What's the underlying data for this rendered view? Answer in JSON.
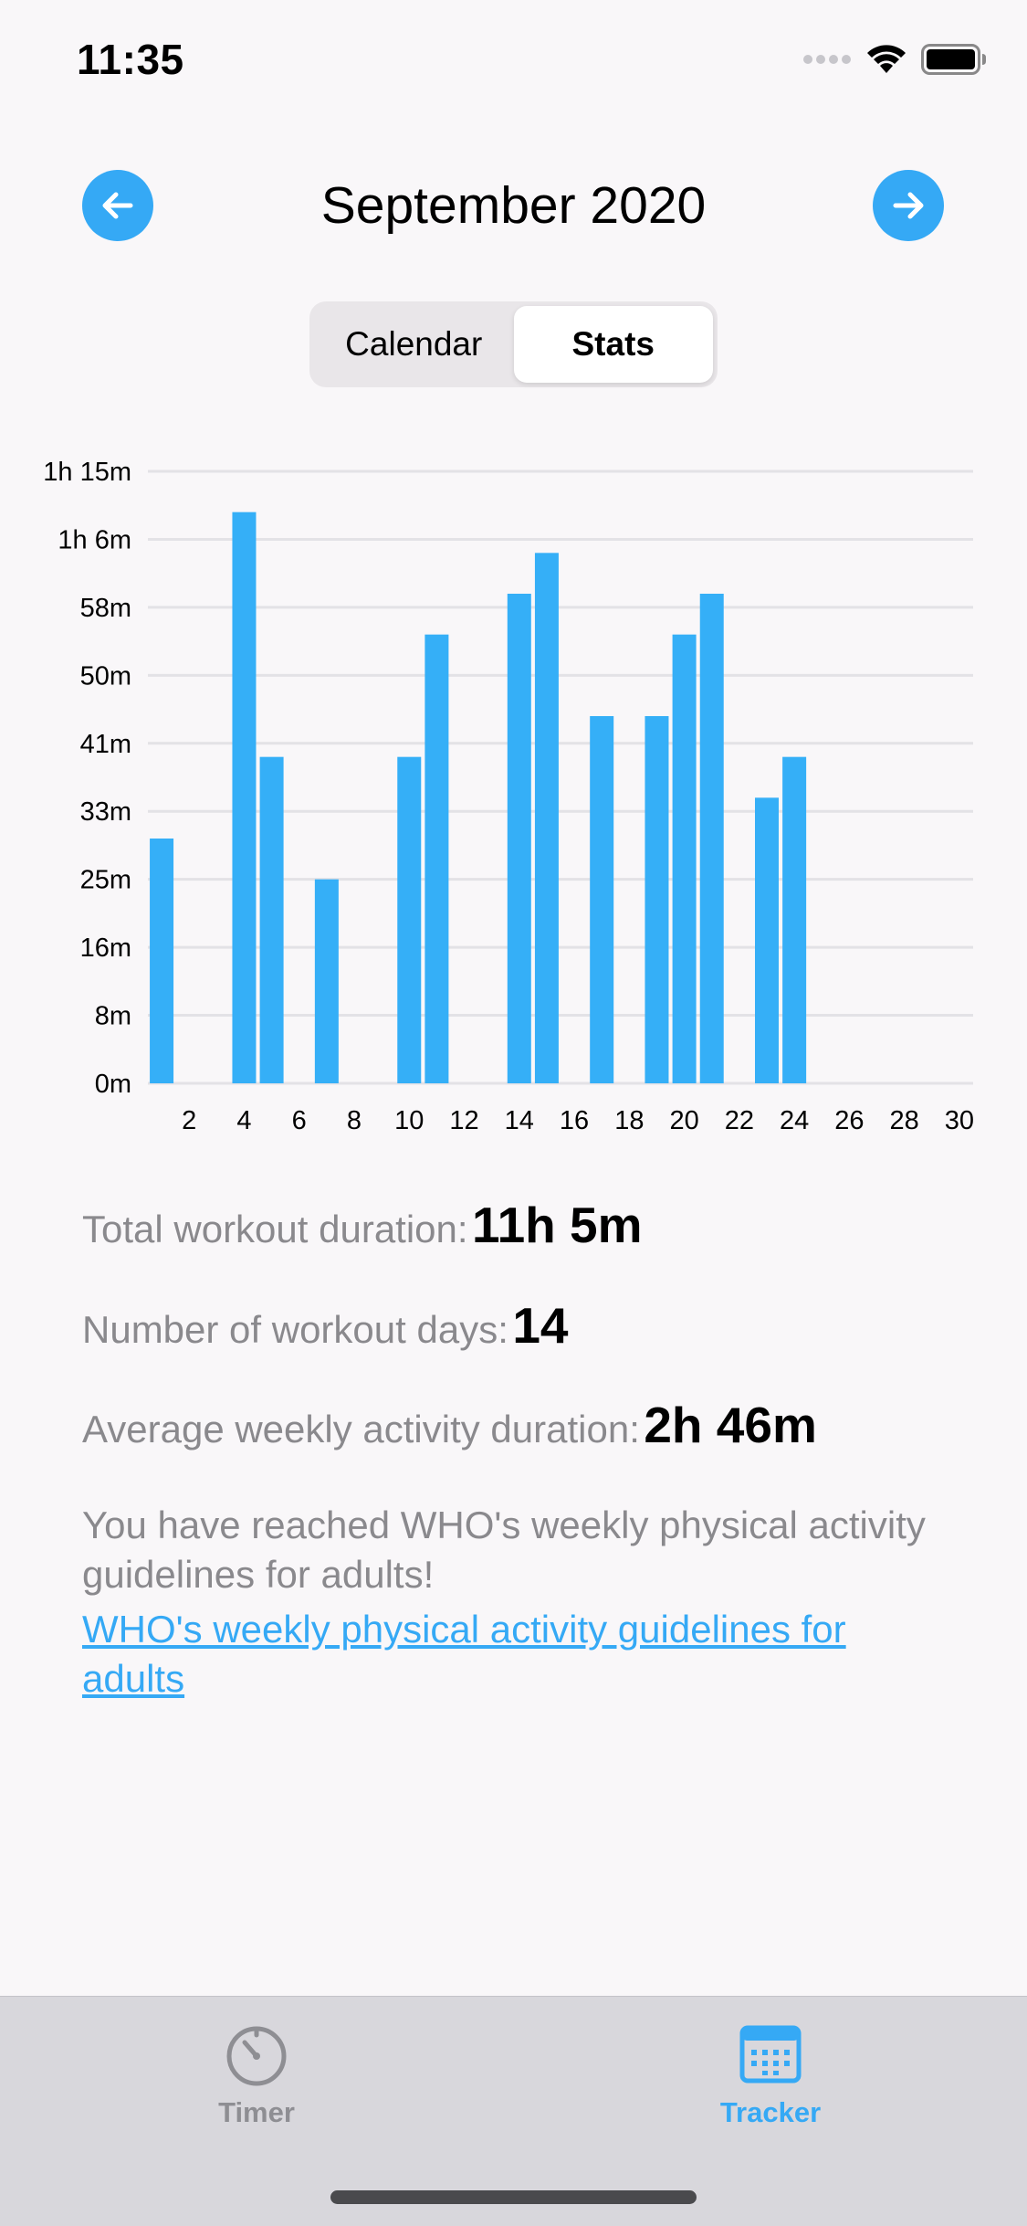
{
  "status_bar": {
    "time": "11:35"
  },
  "header": {
    "title": "September 2020",
    "prev_icon": "arrow-left-icon",
    "next_icon": "arrow-right-icon"
  },
  "segmented": {
    "options": [
      "Calendar",
      "Stats"
    ],
    "selected": "Stats"
  },
  "chart_data": {
    "type": "bar",
    "title": "",
    "xlabel": "",
    "ylabel": "",
    "ylim": [
      0,
      75
    ],
    "y_ticks": [
      "0m",
      "8m",
      "16m",
      "25m",
      "33m",
      "41m",
      "50m",
      "58m",
      "1h 6m",
      "1h 15m"
    ],
    "x_tick_labels": [
      "2",
      "4",
      "6",
      "8",
      "10",
      "12",
      "14",
      "16",
      "18",
      "20",
      "22",
      "24",
      "26",
      "28",
      "30"
    ],
    "days": [
      1,
      2,
      3,
      4,
      5,
      6,
      7,
      8,
      9,
      10,
      11,
      12,
      13,
      14,
      15,
      16,
      17,
      18,
      19,
      20,
      21,
      22,
      23,
      24,
      25,
      26,
      27,
      28,
      29,
      30
    ],
    "values": [
      30,
      0,
      0,
      70,
      40,
      0,
      25,
      0,
      0,
      40,
      55,
      0,
      0,
      60,
      65,
      0,
      45,
      0,
      45,
      55,
      60,
      0,
      35,
      40,
      0,
      0,
      0,
      0,
      0,
      0
    ],
    "grid": true,
    "bar_color": "#35aff7"
  },
  "stats": {
    "total_label": "Total workout duration:",
    "total_value": "11h 5m",
    "days_label": "Number of workout days:",
    "days_value": "14",
    "weekly_label": "Average weekly activity duration:",
    "weekly_value": "2h 46m",
    "message": "You have reached WHO's weekly physical activity guidelines for adults!",
    "link": "WHO's weekly physical activity guidelines for adults"
  },
  "tabbar": {
    "tabs": [
      {
        "label": "Timer",
        "icon": "timer-icon",
        "active": false
      },
      {
        "label": "Tracker",
        "icon": "calendar-icon",
        "active": true
      }
    ]
  },
  "colors": {
    "accent": "#35a9f5",
    "inactive": "#8e8e93",
    "background": "#f9f7f9"
  }
}
